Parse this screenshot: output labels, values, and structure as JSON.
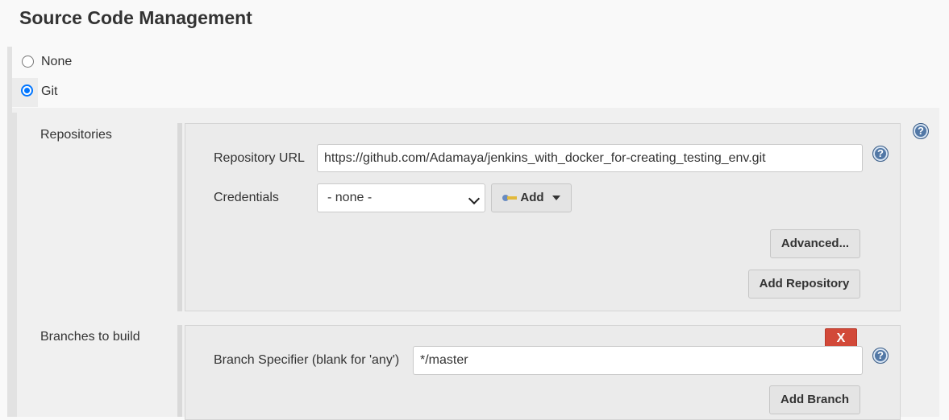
{
  "section": {
    "title": "Source Code Management"
  },
  "scm_options": [
    {
      "label": "None",
      "checked": false
    },
    {
      "label": "Git",
      "checked": true
    }
  ],
  "repositories": {
    "label": "Repositories",
    "repo_url_label": "Repository URL",
    "repo_url_value": "https://github.com/Adamaya/jenkins_with_docker_for-creating_testing_env.git",
    "credentials_label": "Credentials",
    "credentials_selected": "- none -",
    "add_button": "Add",
    "advanced_button": "Advanced...",
    "add_repository_button": "Add Repository"
  },
  "branches": {
    "label": "Branches to build",
    "remove_button": "X",
    "specifier_label": "Branch Specifier (blank for 'any')",
    "specifier_value": "*/master",
    "add_branch_button": "Add Branch"
  },
  "help_glyph": "?",
  "icons": {
    "help": "help-icon",
    "key": "key-icon",
    "caret": "caret-down-icon"
  },
  "colors": {
    "radio_accent": "#0075ff",
    "remove_button": "#d24939",
    "help_icon": "#5278a6"
  }
}
